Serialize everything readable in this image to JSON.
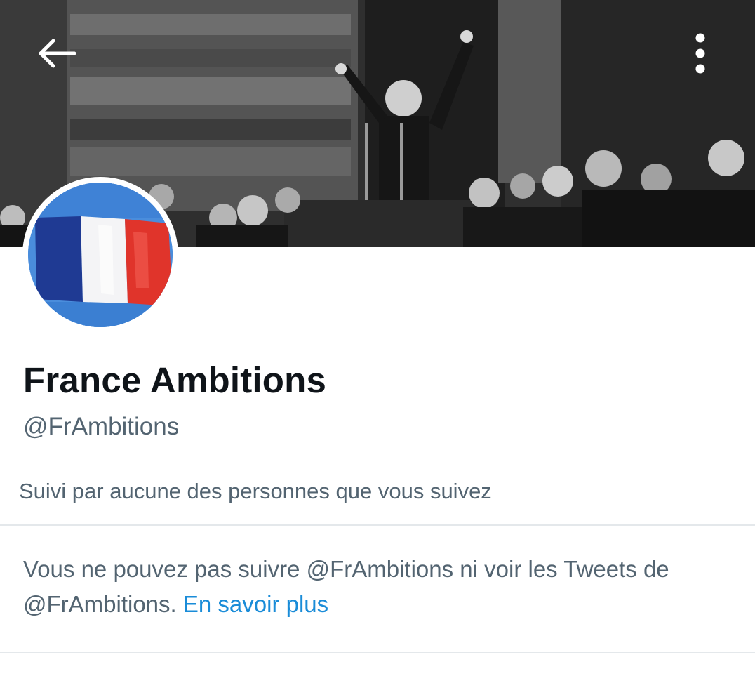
{
  "header": {
    "back_icon": "arrow-left-icon",
    "more_icon": "more-vertical-icon"
  },
  "banner": {
    "description_icon": "header-photo"
  },
  "avatar": {
    "icon": "french-flag-avatar",
    "flag_colors": [
      "#1f3a93",
      "#ffffff",
      "#e0342b"
    ],
    "background": "#4a8ddc"
  },
  "profile": {
    "display_name": "France Ambitions",
    "handle": "@FrAmbitions",
    "followed_by": "Suivi par aucune des personnes que vous suivez"
  },
  "notice": {
    "text": "Vous ne pouvez pas suivre @FrAmbitions ni voir les Tweets de @FrAmbitions.",
    "link_label": "En savoir plus",
    "link_color": "#1a8cd8"
  },
  "colors": {
    "primary_text": "#0f1419",
    "secondary_text": "#536471",
    "divider": "#e4e8eb"
  }
}
